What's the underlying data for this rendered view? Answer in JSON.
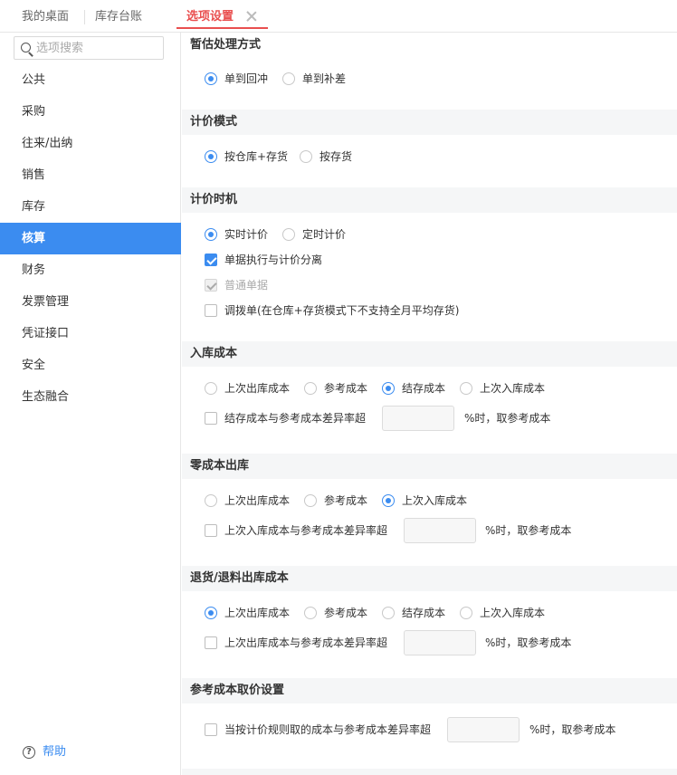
{
  "tabs": [
    {
      "label": "我的桌面"
    },
    {
      "label": "库存台账"
    },
    {
      "label": "选项设置"
    }
  ],
  "search": {
    "placeholder": "选项搜索"
  },
  "sidebar": {
    "items": [
      {
        "label": "公共"
      },
      {
        "label": "采购"
      },
      {
        "label": "往来/出纳"
      },
      {
        "label": "销售"
      },
      {
        "label": "库存"
      },
      {
        "label": "核算"
      },
      {
        "label": "财务"
      },
      {
        "label": "发票管理"
      },
      {
        "label": "凭证接口"
      },
      {
        "label": "安全"
      },
      {
        "label": "生态融合"
      }
    ],
    "active": "核算",
    "help": "帮助"
  },
  "sections": {
    "estimate": {
      "title": "暂估处理方式",
      "options": [
        {
          "label": "单到回冲",
          "selected": true
        },
        {
          "label": "单到补差",
          "selected": false
        }
      ]
    },
    "pricing_mode": {
      "title": "计价模式",
      "options": [
        {
          "label": "按仓库+存货",
          "selected": true
        },
        {
          "label": "按存货",
          "selected": false
        }
      ]
    },
    "pricing_timing": {
      "title": "计价时机",
      "options": [
        {
          "label": "实时计价",
          "selected": true
        },
        {
          "label": "定时计价",
          "selected": false
        }
      ],
      "checks": [
        {
          "label": "单据执行与计价分离",
          "checked": true,
          "disabled": false
        },
        {
          "label": "普通单据",
          "checked": true,
          "disabled": true
        },
        {
          "label": "调拨单(在仓库+存货模式下不支持全月平均存货)",
          "checked": false,
          "disabled": false
        }
      ]
    },
    "inbound_cost": {
      "title": "入库成本",
      "options": [
        {
          "label": "上次出库成本",
          "selected": false
        },
        {
          "label": "参考成本",
          "selected": false
        },
        {
          "label": "结存成本",
          "selected": true
        },
        {
          "label": "上次入库成本",
          "selected": false
        }
      ],
      "rule_label": "结存成本与参考成本差异率超",
      "rule_value": "",
      "rule_suffix": "%时，取参考成本"
    },
    "zero_cost_out": {
      "title": "零成本出库",
      "options": [
        {
          "label": "上次出库成本",
          "selected": false
        },
        {
          "label": "参考成本",
          "selected": false
        },
        {
          "label": "上次入库成本",
          "selected": true
        }
      ],
      "rule_label": "上次入库成本与参考成本差异率超",
      "rule_value": "",
      "rule_suffix": "%时，取参考成本"
    },
    "return_cost": {
      "title": "退货/退料出库成本",
      "options": [
        {
          "label": "上次出库成本",
          "selected": true
        },
        {
          "label": "参考成本",
          "selected": false
        },
        {
          "label": "结存成本",
          "selected": false
        },
        {
          "label": "上次入库成本",
          "selected": false
        }
      ],
      "rule_label": "上次出库成本与参考成本差异率超",
      "rule_value": "",
      "rule_suffix": "%时，取参考成本"
    },
    "ref_cost": {
      "title": "参考成本取价设置",
      "rule_label": "当按计价规则取的成本与参考成本差异率超",
      "rule_value": "",
      "rule_suffix": "%时，取参考成本"
    }
  },
  "colors": {
    "accent": "#3b8cf0",
    "active_tab": "#e94f4f"
  }
}
